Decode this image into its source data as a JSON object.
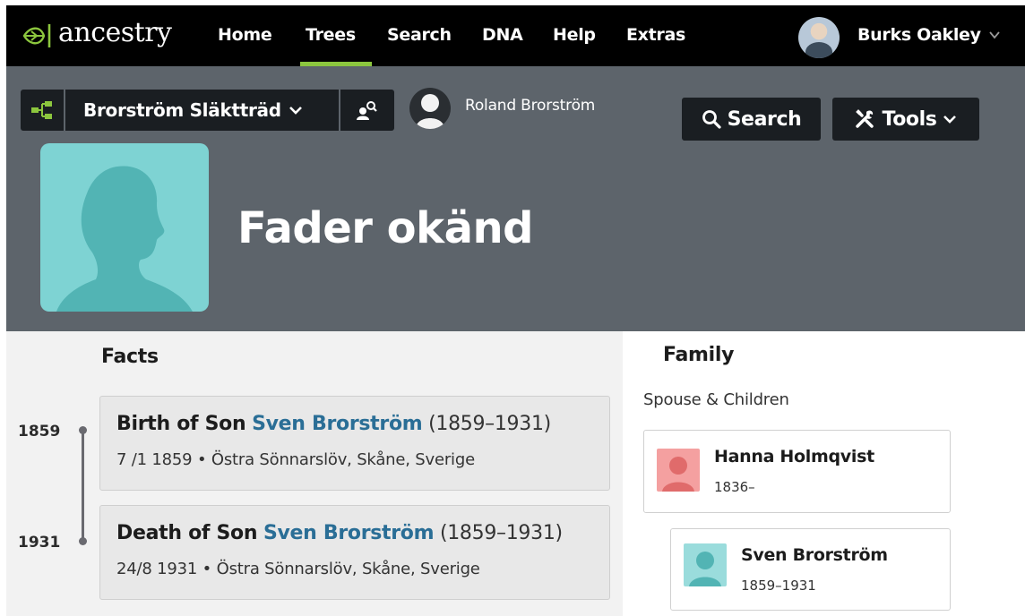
{
  "brand": {
    "logo_text": "ancestry"
  },
  "nav": {
    "items": [
      {
        "label": "Home"
      },
      {
        "label": "Trees"
      },
      {
        "label": "Search"
      },
      {
        "label": "DNA"
      },
      {
        "label": "Help"
      },
      {
        "label": "Extras"
      }
    ],
    "active": "Trees",
    "user_name": "Burks Oakley"
  },
  "tree_bar": {
    "tree_name": "Brorström Släktträd",
    "root_person": "Roland Brorström",
    "search_label": "Search",
    "tools_label": "Tools"
  },
  "person": {
    "name": "Fader okänd"
  },
  "facts": {
    "title": "Facts",
    "items": [
      {
        "year": "1859",
        "event": "Birth of Son",
        "person": "Sven Brorström",
        "dates": "(1859–1931)",
        "detail": "7 /1 1859 • Östra Sönnarslöv, Skåne, Sverige"
      },
      {
        "year": "1931",
        "event": "Death of Son",
        "person": "Sven Brorström",
        "dates": "(1859–1931)",
        "detail": "24/8 1931 • Östra Sönnarslöv, Skåne, Sverige"
      }
    ]
  },
  "family": {
    "title": "Family",
    "section_label": "Spouse & Children",
    "spouse": {
      "name": "Hanna Holmqvist",
      "years": "1836–"
    },
    "children": [
      {
        "name": "Sven Brorström",
        "years": "1859–1931"
      }
    ]
  },
  "colors": {
    "nav_bg": "#000000",
    "nav_active_underline": "#8cc63e",
    "header_bg": "#5d646b",
    "male_silhouette": "#7ed3d3",
    "female_silhouette": "#f08a8a",
    "link": "#2a6e96"
  }
}
